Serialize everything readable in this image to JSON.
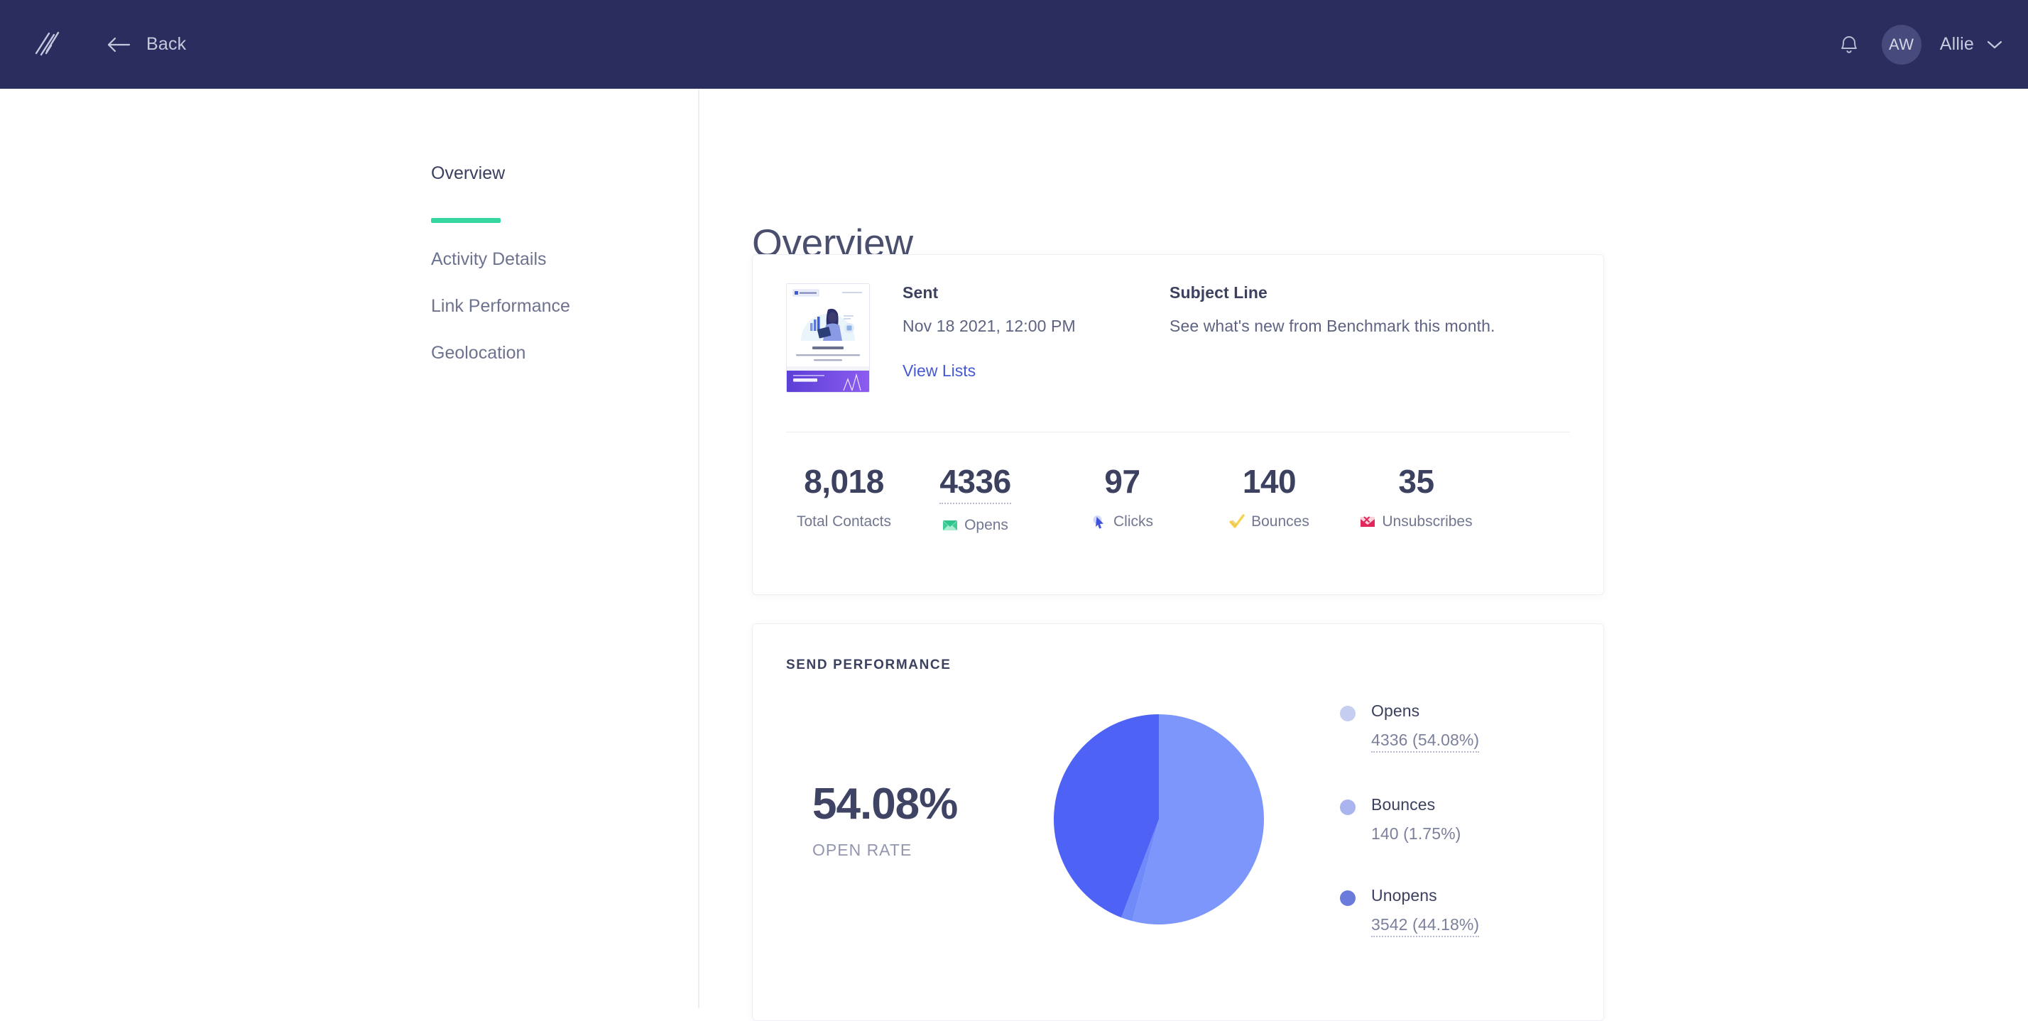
{
  "topbar": {
    "logo_icon": "benchmark-slashes-logo",
    "back_label": "Back",
    "bell_icon": "bell-icon",
    "avatar_initials": "AW",
    "user_name": "Allie",
    "chevron_icon": "chevron-down-icon",
    "background_color": "#2b2d5e"
  },
  "sidebar": {
    "items": [
      {
        "label": "Overview",
        "active": true
      },
      {
        "label": "Activity Details",
        "active": false
      },
      {
        "label": "Link Performance",
        "active": false
      },
      {
        "label": "Geolocation",
        "active": false
      }
    ],
    "active_indicator_color": "#36d6a0"
  },
  "main": {
    "page_title": "Overview"
  },
  "summary_card": {
    "thumbnail_icon": "email-preview-thumbnail",
    "sent": {
      "label": "Sent",
      "value": "Nov 18 2021, 12:00 PM",
      "link": "View Lists"
    },
    "subject": {
      "label": "Subject Line",
      "value": "See what's new from Benchmark this month."
    },
    "stats": [
      {
        "value": "8,018",
        "label": "Total Contacts",
        "icon": "",
        "icon_color": "",
        "dotted": false
      },
      {
        "value": "4336",
        "label": "Opens",
        "icon": "envelope-icon",
        "icon_color": "#35c98d",
        "dotted": true
      },
      {
        "value": "97",
        "label": "Clicks",
        "icon": "cursor-icon",
        "icon_color": "#4558d6",
        "dotted": false
      },
      {
        "value": "140",
        "label": "Bounces",
        "icon": "check-icon",
        "icon_color": "#f4c948",
        "dotted": false
      },
      {
        "value": "35",
        "label": "Unsubscribes",
        "icon": "unsubscribe-icon",
        "icon_color": "#e4295c",
        "dotted": false
      }
    ]
  },
  "performance_card": {
    "kicker": "SEND PERFORMANCE",
    "open_rate_value": "54.08%",
    "open_rate_label": "OPEN RATE"
  },
  "chart_data": {
    "type": "pie",
    "title": "SEND PERFORMANCE",
    "categories": [
      "Opens",
      "Bounces",
      "Unopens"
    ],
    "values": [
      4336,
      140,
      3542
    ],
    "percents": [
      54.08,
      1.75,
      44.18
    ],
    "colors": [
      "#7d96fb",
      "#6f8af9",
      "#4e63f5"
    ],
    "legend_dot_colors": [
      "#c5cdf0",
      "#aab4ee",
      "#6b7bdc"
    ],
    "legend_position": "right",
    "legend": [
      {
        "name": "Opens",
        "value_text": "4336 (54.08%)",
        "dotted": true
      },
      {
        "name": "Bounces",
        "value_text": "140 (1.75%)",
        "dotted": false
      },
      {
        "name": "Unopens",
        "value_text": "3542 (44.18%)",
        "dotted": true
      }
    ],
    "start_angle_deg": 0,
    "direction": "clockwise",
    "total": 8018
  }
}
